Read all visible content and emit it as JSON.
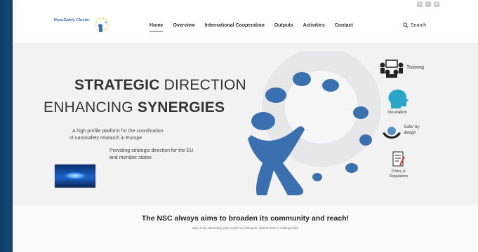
{
  "header": {
    "logo_text": "NanoSafety Cluster",
    "nav": [
      {
        "label": "Home"
      },
      {
        "label": "Overview"
      },
      {
        "label": "International Cooperation"
      },
      {
        "label": "Outputs"
      },
      {
        "label": "Activities"
      },
      {
        "label": "Contact"
      }
    ],
    "search_label": "Search"
  },
  "hero": {
    "headline1_bold": "STRATEGIC",
    "headline1_light": " DIRECTION",
    "headline2_light": "ENHANCING ",
    "headline2_bold": "SYNERGIES",
    "desc_line1": "A high profile platform for the coordination",
    "desc_line2": "of nanosafety research in Europe",
    "desc2_line1": "Providing strategic direction for the EU",
    "desc2_line2": "and member states"
  },
  "side_items": {
    "training": "Training",
    "innovation": "Innovation",
    "safer_line1": "Safer by",
    "safer_line2": "design",
    "policy_line1": "Policy &",
    "policy_line2": "Regulation"
  },
  "bottom": {
    "title": "The NSC always aims to broaden its community and reach!",
    "subtitle": "Join us by submitting your project or joining the desired NSC's mailing list(s)"
  },
  "colors": {
    "accent_blue": "#3a6fb0",
    "slide_background": "#2b78ad",
    "innovation_teal": "#2aa6c9"
  }
}
